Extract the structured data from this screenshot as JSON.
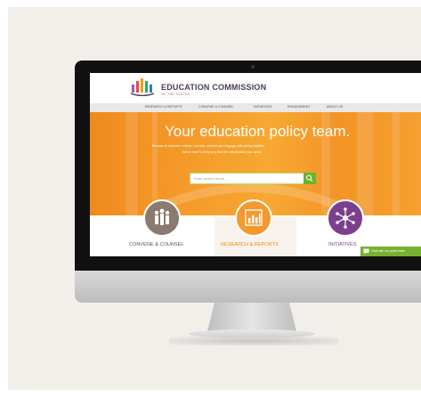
{
  "site": {
    "brand_name": "EDUCATION COMMISSION",
    "brand_tagline": "OF THE STATES"
  },
  "nav": {
    "items": [
      "RESEARCH & REPORTS",
      "CONVENE & COUNSEL",
      "INITIATIVES",
      "ENGAGEMENT",
      "ABOUT US"
    ]
  },
  "hero": {
    "headline": "Your education policy team.",
    "subline_1": "Browse to educate, inform, counsel, search and engage with policy leaders.",
    "subline_2": "We're here to help you find the information you need."
  },
  "search": {
    "placeholder": "Enter search terms..."
  },
  "tiles": [
    {
      "label": "CONVENE & COUNSEL",
      "color": "#8a7a70"
    },
    {
      "label": "RESEARCH & REPORTS",
      "color": "#f29a2e"
    },
    {
      "label": "INITIATIVES",
      "color": "#7b3f8c"
    }
  ],
  "chat": {
    "label": "Chat with our policy team"
  },
  "colors": {
    "accent_orange": "#f39426",
    "search_green": "#6bb22e",
    "brand_purple": "#4a3a5c"
  }
}
